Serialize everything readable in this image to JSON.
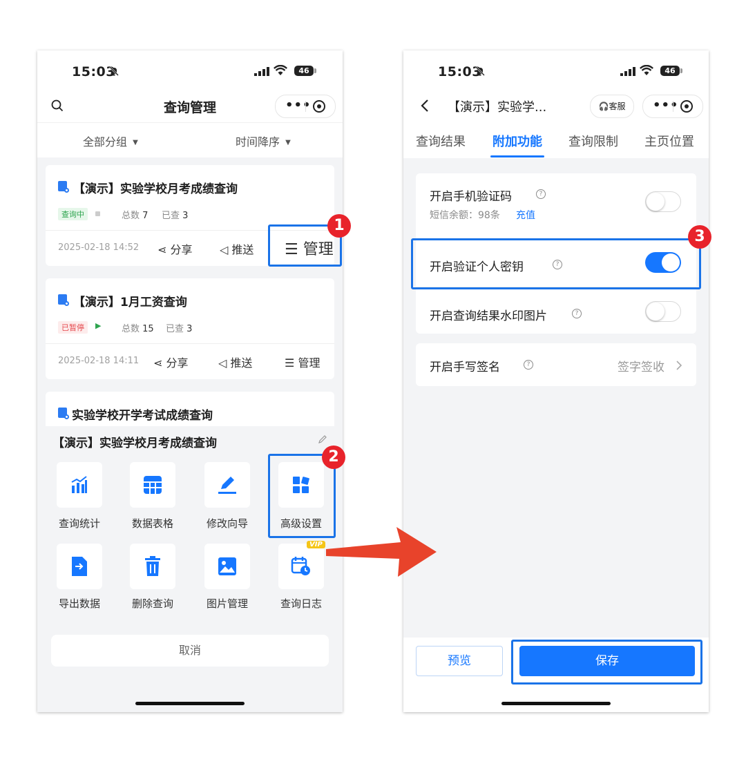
{
  "left": {
    "status_time": "15:03",
    "battery": "46",
    "title": "查询管理",
    "filter_group": "全部分组",
    "filter_sort": "时间降序",
    "cards": [
      {
        "title": "【演示】实验学校月考成绩查询",
        "badge": "查询中",
        "total_label": "总数",
        "total": "7",
        "queried_label": "已查",
        "queried": "3",
        "date": "2025-02-18 14:52",
        "share": "分享",
        "push": "推送",
        "manage": "管理"
      },
      {
        "title": "【演示】1月工资查询",
        "badge": "已暂停",
        "total_label": "总数",
        "total": "15",
        "queried_label": "已查",
        "queried": "3",
        "date": "2025-02-18 14:11",
        "share": "分享",
        "push": "推送",
        "manage": "管理"
      },
      {
        "title": "实验学校开学考试成绩查询"
      }
    ],
    "sheet": {
      "title": "【演示】实验学校月考成绩查询",
      "items": [
        "查询统计",
        "数据表格",
        "修改向导",
        "高级设置",
        "导出数据",
        "删除查询",
        "图片管理",
        "查询日志"
      ],
      "vip": "VIP",
      "cancel": "取消"
    }
  },
  "right": {
    "status_time": "15:03",
    "battery": "46",
    "title": "【演示】实验学...",
    "service": "客服",
    "tabs": [
      "查询结果",
      "附加功能",
      "查询限制",
      "主页位置"
    ],
    "settings": {
      "sms": {
        "label": "开启手机验证码",
        "balance": "短信余额：98条",
        "recharge": "充值"
      },
      "key": {
        "label": "开启验证个人密钥"
      },
      "watermark": {
        "label": "开启查询结果水印图片"
      },
      "signature": {
        "label": "开启手写签名",
        "value": "签字签收"
      }
    },
    "preview": "预览",
    "save": "保存"
  },
  "markers": [
    "1",
    "2",
    "3"
  ],
  "colors": {
    "accent": "#1677ff",
    "highlight": "#1a73e8",
    "marker": "#e8232b",
    "arrow": "#e8432b"
  }
}
